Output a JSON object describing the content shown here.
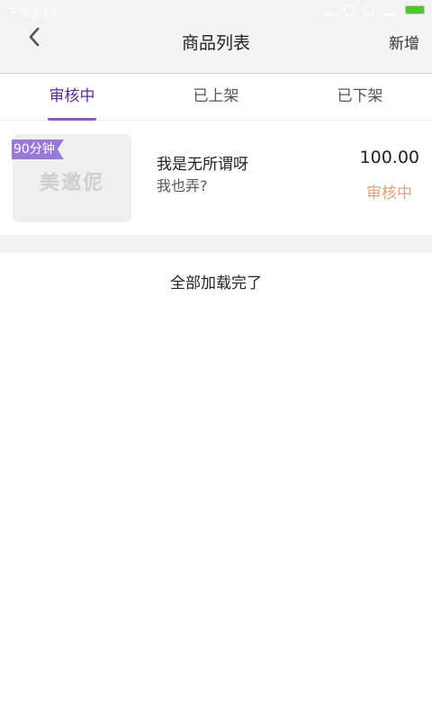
{
  "status_bar": {
    "time": "下午3:59",
    "battery_color": "#4fc72a"
  },
  "header": {
    "back_icon": "chevron-left-icon",
    "title": "商品列表",
    "add_label": "新增"
  },
  "tabs": [
    {
      "label": "审核中",
      "active": true
    },
    {
      "label": "已上架",
      "active": false
    },
    {
      "label": "已下架",
      "active": false
    }
  ],
  "colors": {
    "accent": "#8a5bc7",
    "active_tab_text": "#5a2a8c",
    "status_pending": "#e0a07a"
  },
  "products": [
    {
      "badge": "90分钟",
      "thumbnail_text": "美邀伲",
      "name": "我是无所谓呀",
      "subtitle": "我也弄?",
      "price": "100.00",
      "status": "审核中"
    }
  ],
  "list_footer": "全部加载完了"
}
